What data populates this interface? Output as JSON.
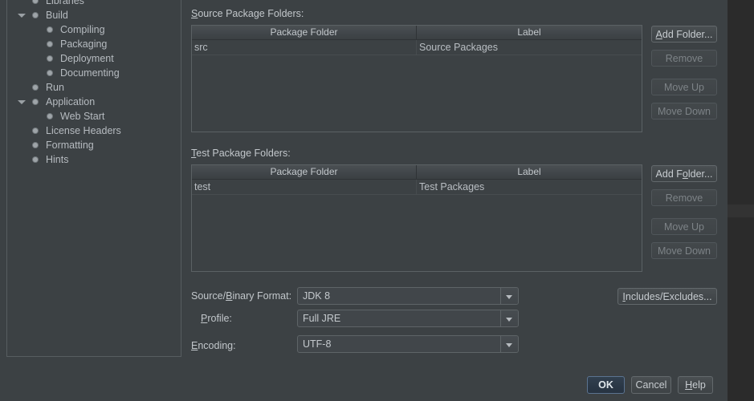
{
  "window": {
    "background_color": "#3c4144",
    "desktop_color": "#2b2b2b"
  },
  "sidebar": {
    "name": "project-categories-tree",
    "items": [
      {
        "label": "Libraries",
        "depth": 1,
        "expandable": false,
        "expanded": false,
        "clipped": true
      },
      {
        "label": "Build",
        "depth": 1,
        "expandable": true,
        "expanded": true,
        "clipped": false
      },
      {
        "label": "Compiling",
        "depth": 2,
        "expandable": false,
        "expanded": false,
        "clipped": false
      },
      {
        "label": "Packaging",
        "depth": 2,
        "expandable": false,
        "expanded": false,
        "clipped": false
      },
      {
        "label": "Deployment",
        "depth": 2,
        "expandable": false,
        "expanded": false,
        "clipped": false
      },
      {
        "label": "Documenting",
        "depth": 2,
        "expandable": false,
        "expanded": false,
        "clipped": false
      },
      {
        "label": "Run",
        "depth": 1,
        "expandable": false,
        "expanded": false,
        "clipped": false
      },
      {
        "label": "Application",
        "depth": 1,
        "expandable": true,
        "expanded": true,
        "clipped": false
      },
      {
        "label": "Web Start",
        "depth": 2,
        "expandable": false,
        "expanded": false,
        "clipped": false
      },
      {
        "label": "License Headers",
        "depth": 1,
        "expandable": false,
        "expanded": false,
        "clipped": false
      },
      {
        "label": "Formatting",
        "depth": 1,
        "expandable": false,
        "expanded": false,
        "clipped": false
      },
      {
        "label": "Hints",
        "depth": 1,
        "expandable": false,
        "expanded": false,
        "clipped": false
      }
    ]
  },
  "source_section": {
    "title": "Source Package Folders:",
    "mnemonic": "S",
    "columns": [
      "Package Folder",
      "Label"
    ],
    "rows": [
      {
        "folder": "src",
        "label": "Source Packages"
      }
    ],
    "buttons": [
      {
        "label": "Add Folder...",
        "mnemonic": "A",
        "enabled": true
      },
      {
        "label": "Remove",
        "mnemonic": "",
        "enabled": false
      },
      {
        "label": "Move Up",
        "mnemonic": "",
        "enabled": false
      },
      {
        "label": "Move Down",
        "mnemonic": "",
        "enabled": false
      }
    ]
  },
  "test_section": {
    "title": "Test Package Folders:",
    "mnemonic": "T",
    "columns": [
      "Package Folder",
      "Label"
    ],
    "rows": [
      {
        "folder": "test",
        "label": "Test Packages"
      }
    ],
    "buttons": [
      {
        "label": "Add Folder...",
        "mnemonic": "o",
        "enabled": true
      },
      {
        "label": "Remove",
        "mnemonic": "",
        "enabled": false
      },
      {
        "label": "Move Up",
        "mnemonic": "",
        "enabled": false
      },
      {
        "label": "Move Down",
        "mnemonic": "",
        "enabled": false
      }
    ]
  },
  "form": {
    "source_binary_format": {
      "label": "Source/Binary Format:",
      "mnemonic": "B",
      "value": "JDK 8"
    },
    "profile": {
      "label": "Profile:",
      "mnemonic": "P",
      "value": "Full JRE"
    },
    "encoding": {
      "label": "Encoding:",
      "mnemonic": "E",
      "value": "UTF-8"
    },
    "includes_excludes_button": {
      "label": "Includes/Excludes...",
      "mnemonic": "I"
    }
  },
  "footer": {
    "ok": {
      "label": "OK",
      "default": true
    },
    "cancel": {
      "label": "Cancel"
    },
    "help": {
      "label": "Help",
      "mnemonic": "H"
    }
  }
}
